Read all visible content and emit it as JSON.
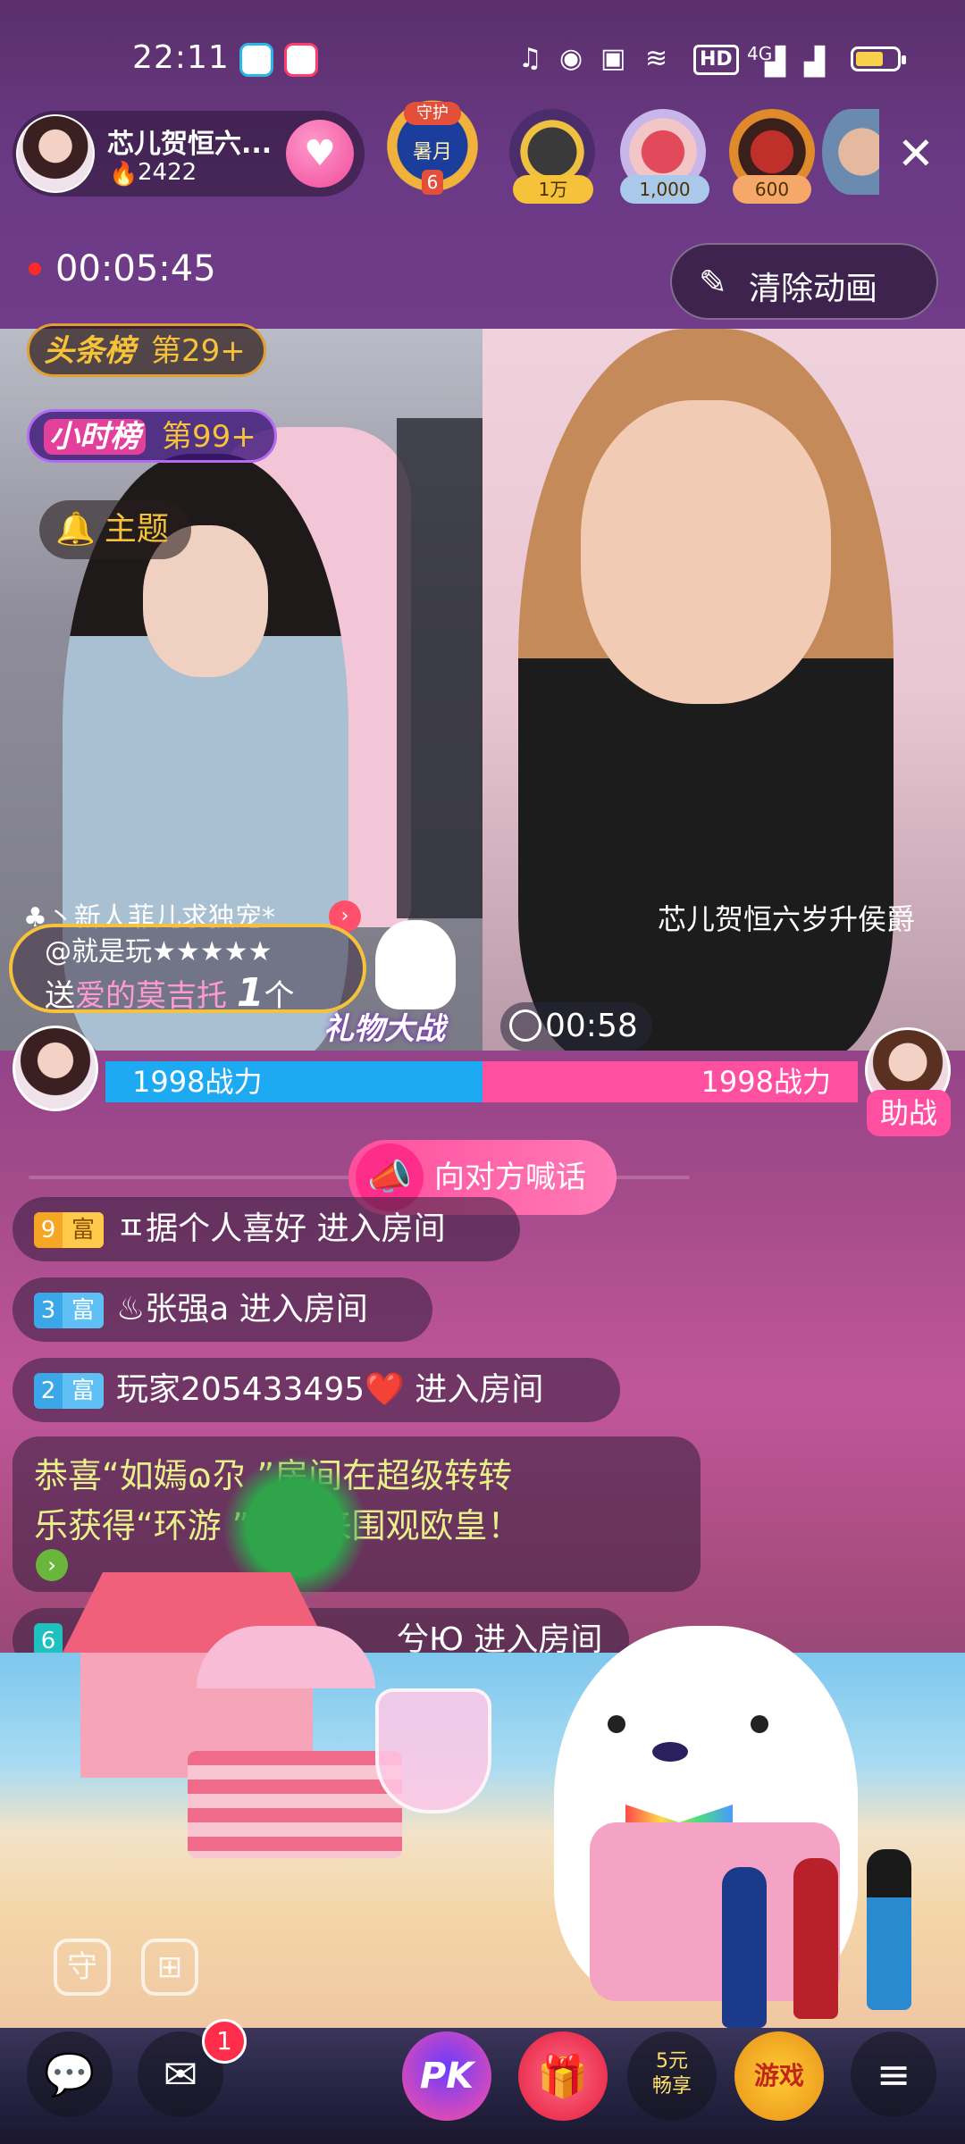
{
  "status_bar": {
    "time": "22:11",
    "network": "4G",
    "hd": "HD",
    "icons": [
      "headphones-icon",
      "mic-icon",
      "camera-icon",
      "wifi-icon",
      "hd-icon",
      "signal-icon",
      "battery-icon"
    ]
  },
  "host": {
    "name": "芯儿贺恒六...",
    "heat": "2422"
  },
  "guard_badge": {
    "label": "守护",
    "title": "暑月",
    "level": "6"
  },
  "top_viewers": [
    {
      "count": "1万"
    },
    {
      "count": "1,000"
    },
    {
      "count": "600"
    }
  ],
  "timer": {
    "elapsed": "00:05:45"
  },
  "clear_animation_label": "清除动画",
  "ranks": {
    "headline_label": "头条榜",
    "headline_rank": "第29+",
    "hourly_label": "小时榜",
    "hourly_rank": "第99+"
  },
  "topic_label": "主题",
  "left_overlay_text": "♣丶新人菲儿求独宠*",
  "right_caption": "芯儿贺恒六岁升侯爵",
  "gift_notice": {
    "user": "@就是玩★★★★★",
    "message_prefix": "送",
    "gift": "爱的莫吉托",
    "count": "1",
    "unit": "个"
  },
  "pk": {
    "label": "礼物大战",
    "countdown": "00:58",
    "left_power": "1998战力",
    "right_power": "1998战力",
    "help_label": "助战"
  },
  "shout_label": "向对方喊话",
  "chat_messages": [
    {
      "level": "9",
      "tag": "富",
      "user": "ㅍ据个人喜好",
      "action": "进入房间",
      "level_color": "#f5a623"
    },
    {
      "level": "3",
      "tag": "富",
      "user": "♨张强a",
      "action": "进入房间",
      "level_color": "#3aa8e8"
    },
    {
      "level": "2",
      "tag": "富",
      "user": "玩家205433495❤️",
      "action": "进入房间",
      "level_color": "#3aa8e8"
    },
    {
      "level": "6",
      "tag": "",
      "user": "兮Ю",
      "action": "进入房间",
      "level_color": "#1ec0c0"
    }
  ],
  "system_message": {
    "line1": "恭喜“如嫣ɷ尕   ”房间在超级转转",
    "line2": "乐获得“环游  ”，快来围观欧皇！"
  },
  "bottom_bar": {
    "chat_badge": "1",
    "pk": "PK",
    "promo_line1": "5元",
    "promo_line2": "畅享",
    "game": "游戏"
  }
}
